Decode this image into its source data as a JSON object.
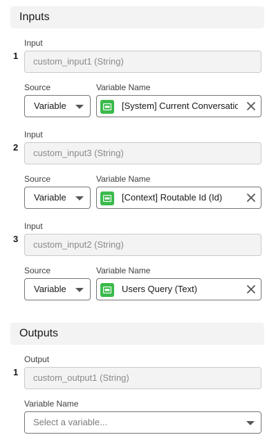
{
  "inputs": {
    "title": "Inputs",
    "items": [
      {
        "index": "1",
        "input_label": "Input",
        "input_value": "custom_input1 (String)",
        "source_label": "Source",
        "source_value": "Variable",
        "variable_label": "Variable Name",
        "variable_value": "[System] Current Conversation"
      },
      {
        "index": "2",
        "input_label": "Input",
        "input_value": "custom_input3 (String)",
        "source_label": "Source",
        "source_value": "Variable",
        "variable_label": "Variable Name",
        "variable_value": "[Context] Routable Id (Id)"
      },
      {
        "index": "3",
        "input_label": "Input",
        "input_value": "custom_input2 (String)",
        "source_label": "Source",
        "source_value": "Variable",
        "variable_label": "Variable Name",
        "variable_value": "Users Query (Text)"
      }
    ]
  },
  "outputs": {
    "title": "Outputs",
    "items": [
      {
        "index": "1",
        "output_label": "Output",
        "output_value": "custom_output1 (String)",
        "variable_label": "Variable Name",
        "variable_placeholder": "Select a variable..."
      }
    ]
  },
  "icons": {
    "variable": "text-variable-icon",
    "clear": "close-icon",
    "dropdown": "chevron-down-icon"
  },
  "colors": {
    "variable_icon_bg": "#3bba4c",
    "section_header_bg": "#f3f3f3"
  }
}
